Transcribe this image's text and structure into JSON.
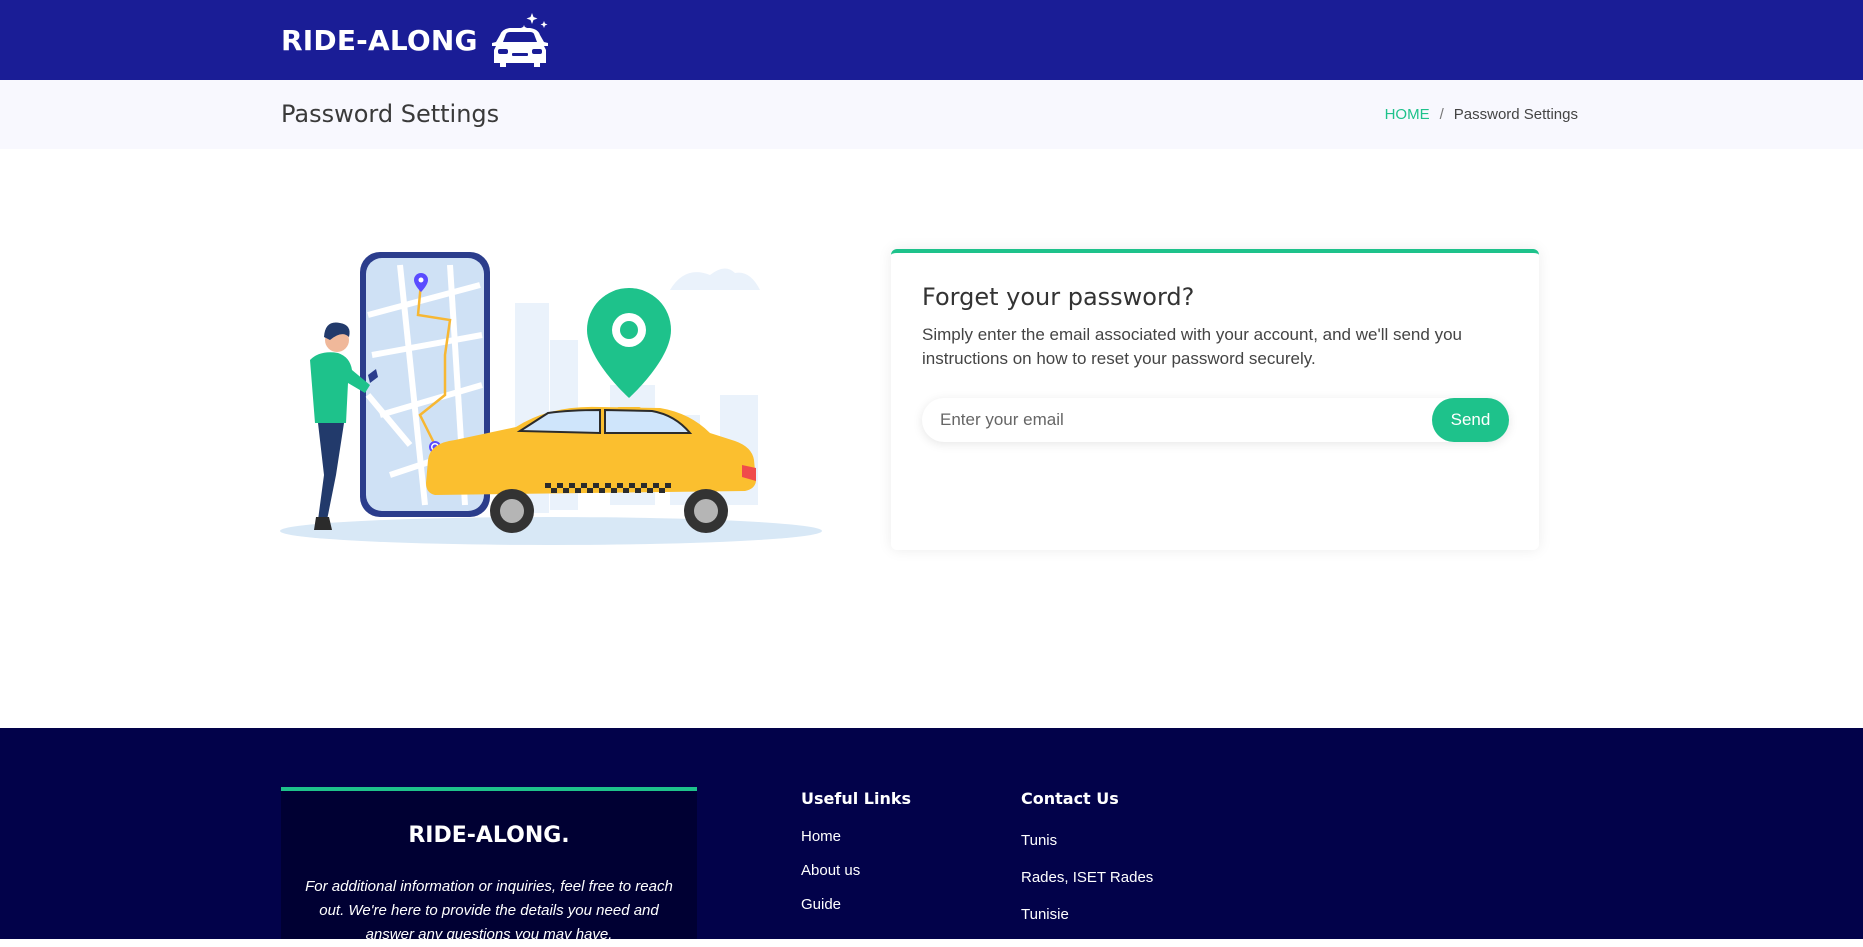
{
  "header": {
    "brand": "RIDE-ALONG",
    "logo_icon": "car-sparkle-icon"
  },
  "title_band": {
    "title": "Password Settings",
    "breadcrumb": {
      "home": "HOME",
      "separator": "/",
      "current": "Password Settings"
    }
  },
  "illustration": {
    "name": "taxi-map-illustration"
  },
  "reset_card": {
    "title": "Forget your password?",
    "description": "Simply enter the email associated with your account, and we'll send you instructions on how to reset your password securely.",
    "email_placeholder": "Enter your email",
    "email_value": "",
    "send_label": "Send"
  },
  "footer": {
    "brand": "RIDE-ALONG.",
    "about_text": "For additional information or inquiries, feel free to reach out. We're here to provide the details you need and answer any questions you may have.",
    "useful_links": {
      "heading": "Useful Links",
      "items": [
        "Home",
        "About us",
        "Guide"
      ]
    },
    "contact": {
      "heading": "Contact Us",
      "items": [
        "Tunis",
        "Rades, ISET Rades",
        "Tunisie"
      ]
    }
  },
  "colors": {
    "header_bg": "#1a1d96",
    "accent": "#1ec28b",
    "footer_bg": "#02024a",
    "footer_about_bg": "#000033",
    "taxi_yellow": "#fbbf2f"
  }
}
